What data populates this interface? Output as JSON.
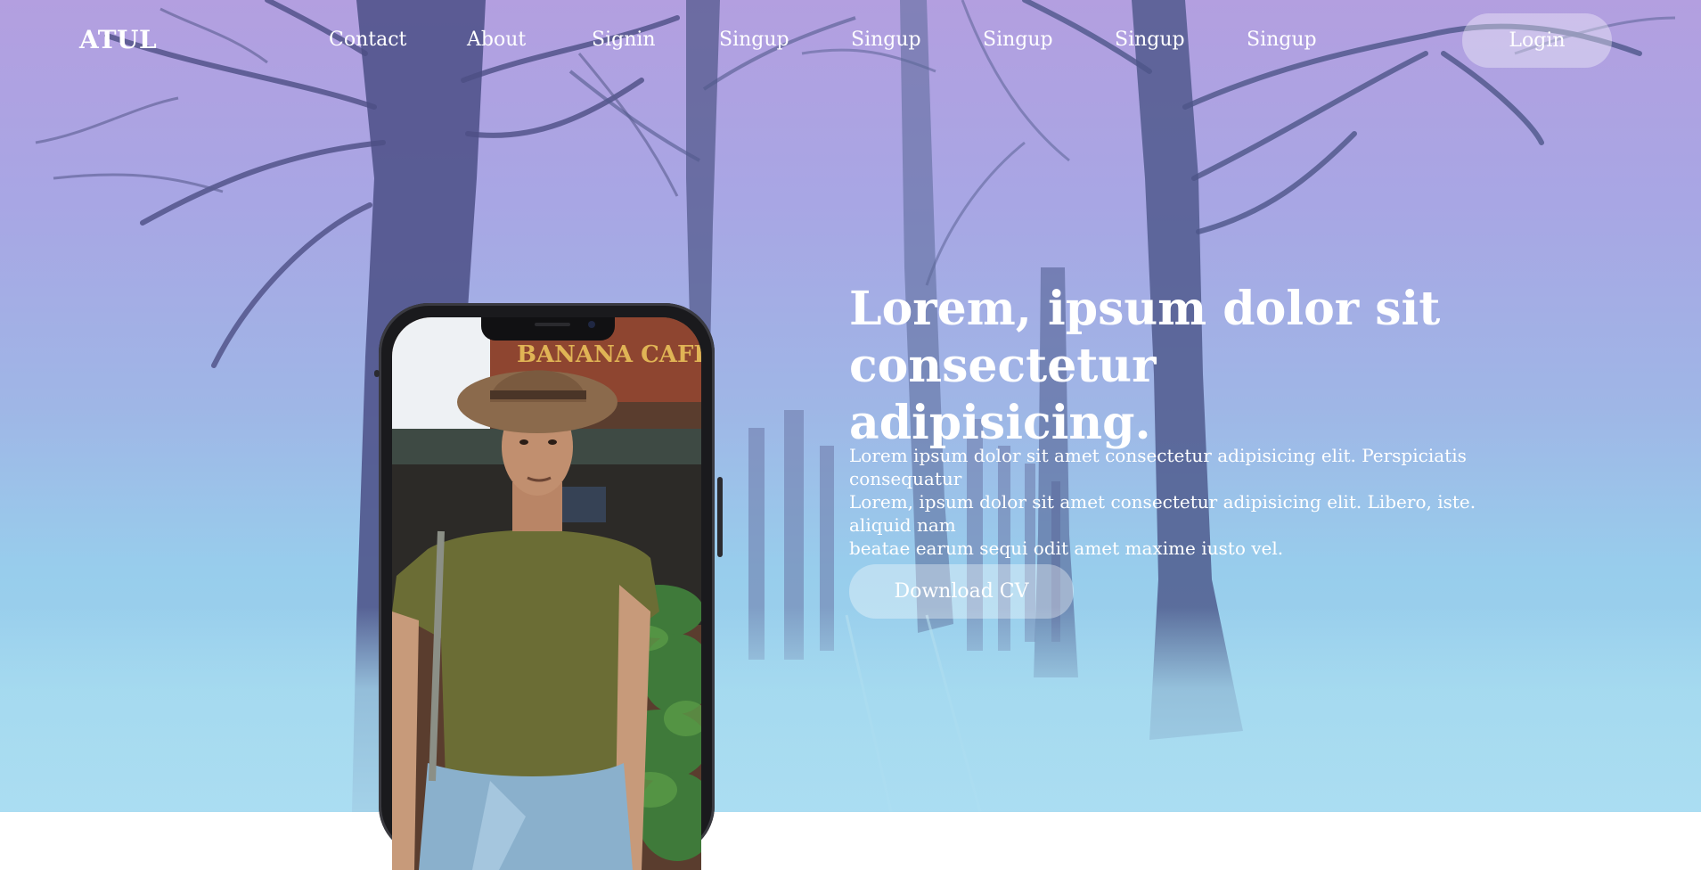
{
  "brand": {
    "logo": "ATUL"
  },
  "nav": {
    "links": [
      "Contact",
      "About",
      "Signin",
      "Singup",
      "Singup",
      "Singup",
      "Singup",
      "Singup"
    ],
    "login_label": "Login"
  },
  "hero": {
    "title_line1": "Lorem, ipsum dolor sit",
    "title_line2": "consectetur adipisicing.",
    "body_line1": "Lorem ipsum dolor sit amet consectetur adipisicing elit. Perspiciatis consequatur",
    "body_line2": "Lorem, ipsum dolor sit amet consectetur adipisicing elit. Libero, iste. aliquid nam",
    "body_line3": "beatae earum sequi odit amet maxime iusto vel.",
    "cta_label": "Download CV"
  },
  "phone_screen": {
    "storefront_sign": "BANANA CAFE"
  },
  "colors": {
    "sky_top": "#b39fe0",
    "sky_bottom": "#9fd6ee",
    "button_bg": "rgba(255,255,255,0.35)",
    "text": "#ffffff"
  }
}
